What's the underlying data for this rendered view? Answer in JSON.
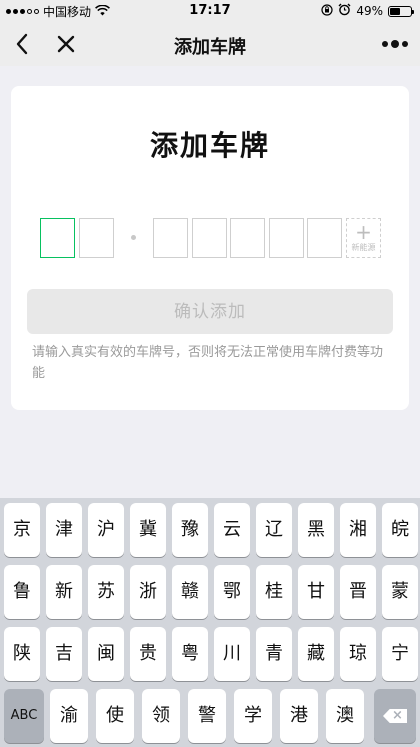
{
  "status_bar": {
    "carrier": "中国移动",
    "time": "17:17",
    "battery_percent": "49%",
    "battery_level": 0.49,
    "icons": [
      "signal-icon",
      "wifi-icon",
      "orientation-lock-icon",
      "alarm-icon",
      "battery-icon"
    ]
  },
  "nav": {
    "title": "添加车牌",
    "back_icon": "chevron-left-icon",
    "close_icon": "close-icon",
    "more_icon": "more-dots-icon"
  },
  "card": {
    "title": "添加车牌",
    "plate": {
      "boxes_before_dot": 2,
      "boxes_after_dot": 5,
      "new_energy_plus": "+",
      "new_energy_label": "新能源"
    },
    "confirm_label": "确认添加",
    "hint": "请输入真实有效的车牌号，否则将无法正常使用车牌付费等功能"
  },
  "keyboard": {
    "rows": [
      [
        "京",
        "津",
        "沪",
        "冀",
        "豫",
        "云",
        "辽",
        "黑",
        "湘",
        "皖"
      ],
      [
        "鲁",
        "新",
        "苏",
        "浙",
        "赣",
        "鄂",
        "桂",
        "甘",
        "晋",
        "蒙"
      ],
      [
        "陕",
        "吉",
        "闽",
        "贵",
        "粤",
        "川",
        "青",
        "藏",
        "琼",
        "宁"
      ]
    ],
    "bottom_row": {
      "abc_label": "ABC",
      "keys": [
        "渝",
        "使",
        "领",
        "警",
        "学",
        "港",
        "澳"
      ],
      "delete_icon": "backspace-icon"
    },
    "colors": {
      "background": "#d2d5db",
      "key": "#ffffff",
      "function_key": "#acb1b9"
    }
  },
  "colors": {
    "accent": "#07c160",
    "page_background": "#efeff4"
  }
}
